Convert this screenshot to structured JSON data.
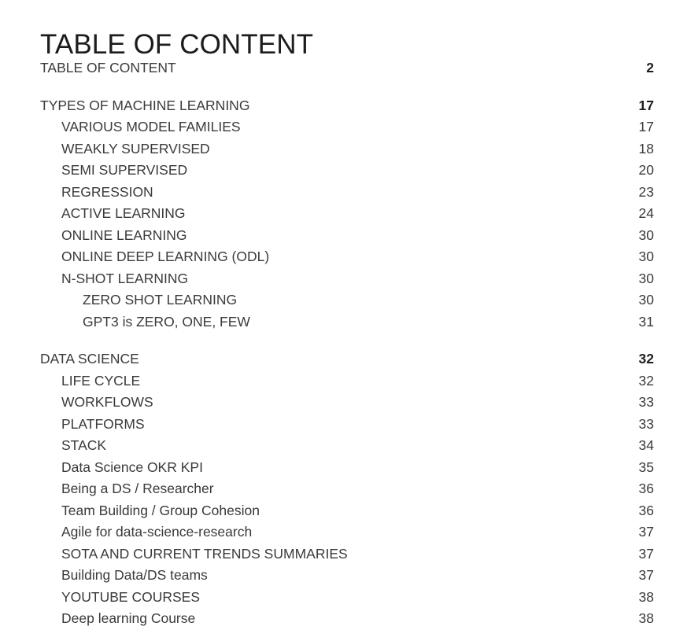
{
  "document": {
    "title": "TABLE OF CONTENT"
  },
  "toc": {
    "entries": [
      {
        "label": "TABLE OF CONTENT",
        "page": "2",
        "level": 0,
        "gap_before": false
      },
      {
        "label": "TYPES OF MACHINE LEARNING",
        "page": "17",
        "level": 0,
        "gap_before": true
      },
      {
        "label": "VARIOUS MODEL FAMILIES",
        "page": "17",
        "level": 1,
        "gap_before": false
      },
      {
        "label": "WEAKLY SUPERVISED",
        "page": "18",
        "level": 1,
        "gap_before": false
      },
      {
        "label": "SEMI SUPERVISED",
        "page": "20",
        "level": 1,
        "gap_before": false
      },
      {
        "label": "REGRESSION",
        "page": "23",
        "level": 1,
        "gap_before": false
      },
      {
        "label": "ACTIVE LEARNING",
        "page": "24",
        "level": 1,
        "gap_before": false
      },
      {
        "label": "ONLINE LEARNING",
        "page": "30",
        "level": 1,
        "gap_before": false
      },
      {
        "label": "ONLINE DEEP LEARNING (ODL)",
        "page": "30",
        "level": 1,
        "gap_before": false
      },
      {
        "label": "N-SHOT LEARNING",
        "page": "30",
        "level": 1,
        "gap_before": false
      },
      {
        "label": "ZERO SHOT LEARNING",
        "page": "30",
        "level": 2,
        "gap_before": false
      },
      {
        "label": "GPT3 is ZERO, ONE, FEW",
        "page": "31",
        "level": 2,
        "gap_before": false
      },
      {
        "label": "DATA SCIENCE",
        "page": "32",
        "level": 0,
        "gap_before": true
      },
      {
        "label": "LIFE CYCLE",
        "page": "32",
        "level": 1,
        "gap_before": false
      },
      {
        "label": "WORKFLOWS",
        "page": "33",
        "level": 1,
        "gap_before": false
      },
      {
        "label": "PLATFORMS",
        "page": "33",
        "level": 1,
        "gap_before": false
      },
      {
        "label": "STACK",
        "page": "34",
        "level": 1,
        "gap_before": false
      },
      {
        "label": "Data Science OKR KPI",
        "page": "35",
        "level": 1,
        "gap_before": false
      },
      {
        "label": "Being a DS / Researcher",
        "page": "36",
        "level": 1,
        "gap_before": false
      },
      {
        "label": "Team Building / Group Cohesion",
        "page": "36",
        "level": 1,
        "gap_before": false
      },
      {
        "label": "Agile for data-science-research",
        "page": "37",
        "level": 1,
        "gap_before": false
      },
      {
        "label": "SOTA AND CURRENT TRENDS SUMMARIES",
        "page": "37",
        "level": 1,
        "gap_before": false
      },
      {
        "label": "Building Data/DS teams",
        "page": "37",
        "level": 1,
        "gap_before": false
      },
      {
        "label": "YOUTUBE COURSES",
        "page": "38",
        "level": 1,
        "gap_before": false
      },
      {
        "label": "Deep learning Course",
        "page": "38",
        "level": 1,
        "gap_before": false
      }
    ]
  },
  "colors": {
    "background": "#ffffff",
    "text": "#3a3a3a",
    "title_text": "#1c1c1c",
    "page_number_bold": "#1e1e1e"
  }
}
